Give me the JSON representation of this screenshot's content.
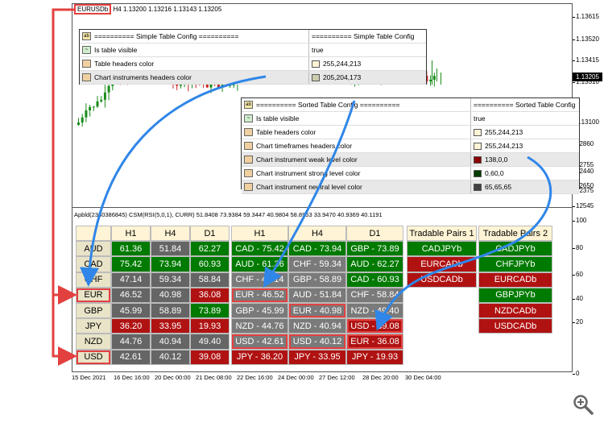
{
  "chart": {
    "symbol": "EURUSDb",
    "timeframe": "H4",
    "ohlc": "1.13200 1.13216 1.13143 1.13205",
    "current_price": "1.13205",
    "price_ticks": [
      "1.13615",
      "1.13520",
      "1.13415",
      "1.13310",
      "1.13205",
      "1.13100",
      "12860",
      "12755",
      "12650",
      "12545",
      "12440",
      "12375",
      "100",
      "80",
      "60",
      "40",
      "20",
      "0"
    ],
    "indicator_label": "Apbld(2330386845) CSM(RSI(5,0,1), CURR) 51.8408 73.9384 59.3447 40.9804 58.8953 33.9470 40.9369 40.1191",
    "time_ticks": [
      "15 Dec 2021",
      "16 Dec 16:00",
      "20 Dec 00:00",
      "21 Dec 08:00",
      "22 Dec 16:00",
      "24 Dec 00:00",
      "27 Dec 12:00",
      "28 Dec 20:00",
      "30 Dec 04:00"
    ]
  },
  "simple_config": {
    "header_left": "========== Simple Table Config ==========",
    "header_right": "========== Simple Table Config",
    "rows": [
      {
        "label": "Is table visible",
        "value": "true"
      },
      {
        "label": "Table headers color",
        "value": "255,244,213",
        "swatch": "#fff4d5"
      },
      {
        "label": "Chart instruments headers color",
        "value": "205,204,173",
        "swatch": "#cdccad"
      }
    ]
  },
  "sorted_config": {
    "header_left": "========== Sorted Table Config ==========",
    "header_right": "========== Sorted Table Config",
    "rows": [
      {
        "label": "Is table visible",
        "value": "true"
      },
      {
        "label": "Table headers color",
        "value": "255,244,213",
        "swatch": "#fff4d5"
      },
      {
        "label": "Chart timeframes headers color",
        "value": "255,244,213",
        "swatch": "#fff4d5"
      },
      {
        "label": "Chart instrument weak level color",
        "value": "138,0,0",
        "swatch": "#8a0000"
      },
      {
        "label": "Chart instrument strong level color",
        "value": "0,60,0",
        "swatch": "#003c00"
      },
      {
        "label": "Chart instrument neutral level color",
        "value": "65,65,65",
        "swatch": "#414141"
      }
    ]
  },
  "simple_table": {
    "headers": [
      "H1",
      "H4",
      "D1"
    ],
    "rows": [
      {
        "currency": "AUD",
        "values": [
          "61.36",
          "51.84",
          "62.27"
        ],
        "levels": [
          "strong",
          "neutral",
          "strong"
        ]
      },
      {
        "currency": "CAD",
        "values": [
          "75.42",
          "73.94",
          "60.93"
        ],
        "levels": [
          "strong",
          "strong",
          "strong"
        ]
      },
      {
        "currency": "CHF",
        "values": [
          "47.14",
          "59.34",
          "58.84"
        ],
        "levels": [
          "neutral",
          "neutral",
          "neutral"
        ]
      },
      {
        "currency": "EUR",
        "values": [
          "46.52",
          "40.98",
          "36.08"
        ],
        "levels": [
          "neutral",
          "neutral",
          "weak"
        ]
      },
      {
        "currency": "GBP",
        "values": [
          "45.99",
          "58.89",
          "73.89"
        ],
        "levels": [
          "neutral",
          "neutral",
          "strong"
        ]
      },
      {
        "currency": "JPY",
        "values": [
          "36.20",
          "33.95",
          "19.93"
        ],
        "levels": [
          "weak",
          "weak",
          "weak"
        ]
      },
      {
        "currency": "NZD",
        "values": [
          "44.76",
          "40.94",
          "49.40"
        ],
        "levels": [
          "neutral",
          "neutral",
          "neutral"
        ]
      },
      {
        "currency": "USD",
        "values": [
          "42.61",
          "40.12",
          "39.08"
        ],
        "levels": [
          "neutral",
          "neutral",
          "weak"
        ]
      }
    ]
  },
  "sorted_table": {
    "headers": [
      "H1",
      "H4",
      "D1"
    ],
    "columns": [
      [
        {
          "text": "CAD - 75.42",
          "level": "strong"
        },
        {
          "text": "AUD - 61.36",
          "level": "strong"
        },
        {
          "text": "CHF - 47.14",
          "level": "neutral"
        },
        {
          "text": "EUR - 46.52",
          "level": "neutral",
          "highlight": true
        },
        {
          "text": "GBP - 45.99",
          "level": "neutral"
        },
        {
          "text": "NZD - 44.76",
          "level": "neutral"
        },
        {
          "text": "USD - 42.61",
          "level": "neutral",
          "highlight": true
        },
        {
          "text": "JPY - 36.20",
          "level": "weak"
        }
      ],
      [
        {
          "text": "CAD - 73.94",
          "level": "strong"
        },
        {
          "text": "CHF - 59.34",
          "level": "neutral"
        },
        {
          "text": "GBP - 58.89",
          "level": "neutral"
        },
        {
          "text": "AUD - 51.84",
          "level": "neutral"
        },
        {
          "text": "EUR - 40.98",
          "level": "neutral",
          "highlight": true
        },
        {
          "text": "NZD - 40.94",
          "level": "neutral"
        },
        {
          "text": "USD - 40.12",
          "level": "neutral",
          "highlight": true
        },
        {
          "text": "JPY - 33.95",
          "level": "weak"
        }
      ],
      [
        {
          "text": "GBP - 73.89",
          "level": "strong"
        },
        {
          "text": "AUD - 62.27",
          "level": "strong"
        },
        {
          "text": "CAD - 60.93",
          "level": "strong"
        },
        {
          "text": "CHF - 58.84",
          "level": "neutral"
        },
        {
          "text": "NZD - 49.40",
          "level": "neutral"
        },
        {
          "text": "USD - 39.08",
          "level": "weak",
          "highlight": true
        },
        {
          "text": "EUR - 36.08",
          "level": "weak",
          "highlight": true
        },
        {
          "text": "JPY - 19.93",
          "level": "weak"
        }
      ]
    ]
  },
  "tradable_pairs_1": {
    "header": "Tradable Pairs 1",
    "items": [
      {
        "text": "CADJPYb",
        "level": "strong"
      },
      {
        "text": "EURCADb",
        "level": "weak"
      },
      {
        "text": "USDCADb",
        "level": "weak"
      }
    ]
  },
  "tradable_pairs_2": {
    "header": "Tradable Pairs 2",
    "items": [
      {
        "text": "CADJPYb",
        "level": "strong"
      },
      {
        "text": "CHFJPYb",
        "level": "strong"
      },
      {
        "text": "EURCADb",
        "level": "weak"
      },
      {
        "text": "GBPJPYb",
        "level": "strong"
      },
      {
        "text": "NZDCADb",
        "level": "weak"
      },
      {
        "text": "USDCADb",
        "level": "weak"
      }
    ]
  },
  "colors": {
    "strong": "#007a00",
    "weak": "#b01212",
    "neutral": "#656565",
    "neutral_sorted": "#7a7a7a",
    "table_header": "#fff4d5",
    "instrument_header": "#e9e4c8",
    "annotation_red": "#e34040",
    "annotation_blue": "#2f86e8",
    "bull_candle": "#1a8c1a",
    "bear_candle": "#cc2020"
  },
  "icons": {
    "zoom": "zoom-in-icon",
    "text_field": "ab-icon",
    "toggle": "toggle-icon",
    "color": "color-icon"
  }
}
